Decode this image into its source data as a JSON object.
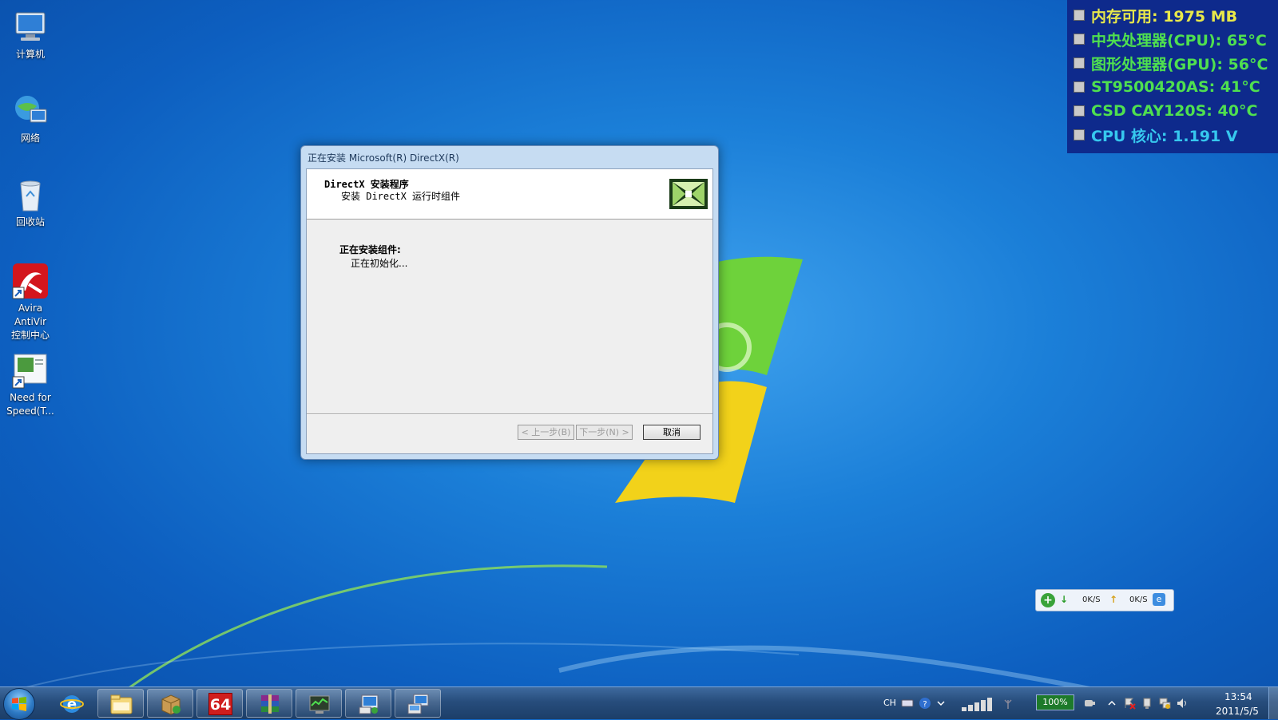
{
  "desktop": {
    "icons": [
      {
        "label": "计算机",
        "icon": "computer-icon"
      },
      {
        "label": "网络",
        "icon": "network-icon"
      },
      {
        "label": "回收站",
        "icon": "recycle-bin-icon"
      },
      {
        "label": "Avira AntiVir\n控制中心",
        "icon": "avira-icon"
      },
      {
        "label": "Need for\nSpeed(T...",
        "icon": "shortcut-icon"
      }
    ]
  },
  "hardware_monitor": {
    "rows": [
      {
        "text": "内存可用: 1975 MB",
        "color": "#e8e84a",
        "icon": "memory-icon"
      },
      {
        "text": "中央处理器(CPU): 65°C",
        "color": "#4fe04f",
        "icon": "cpu-icon"
      },
      {
        "text": "图形处理器(GPU): 56°C",
        "color": "#4fe04f",
        "icon": "gpu-icon"
      },
      {
        "text": "ST9500420AS: 41°C",
        "color": "#4fe04f",
        "icon": "hdd-icon"
      },
      {
        "text": "CSD CAY120S: 40°C",
        "color": "#4fe04f",
        "icon": "hdd-icon"
      },
      {
        "text": "CPU 核心: 1.191 V",
        "color": "#36c8ee",
        "icon": "cpu-core-icon"
      }
    ]
  },
  "dialog": {
    "title": "正在安装 Microsoft(R) DirectX(R)",
    "header_title": "DirectX 安装程序",
    "header_subtitle": "安装 DirectX 运行时组件",
    "logo_icon": "directx-logo-icon",
    "body_title": "正在安装组件:",
    "body_status": "正在初始化...",
    "buttons": {
      "back": "< 上一步(B)",
      "next": "下一步(N) >",
      "cancel": "取消"
    }
  },
  "netspeed": {
    "down": "0K/S",
    "up": "0K/S"
  },
  "taskbar": {
    "apps": [
      {
        "name": "internet-explorer-icon"
      },
      {
        "name": "windows-explorer-icon"
      },
      {
        "name": "installer-package-icon"
      },
      {
        "name": "aida64-icon",
        "label": "64"
      },
      {
        "name": "winrar-icon"
      },
      {
        "name": "hardware-monitor-icon"
      },
      {
        "name": "directx-setup-icon"
      },
      {
        "name": "setup-computer-icon"
      }
    ],
    "tray": {
      "lang": "CH",
      "battery": "100%",
      "time": "13:54",
      "date": "2011/5/5"
    }
  }
}
